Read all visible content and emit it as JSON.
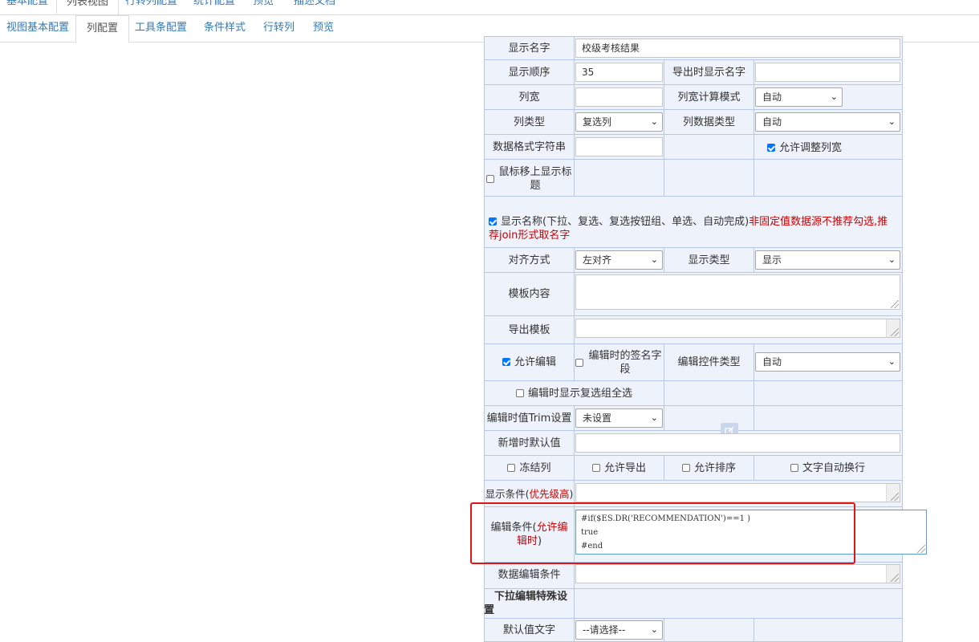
{
  "top_tabs": [
    "基本配置",
    "列表视图",
    "行转列配置",
    "统计配置",
    "预览",
    "描述文档"
  ],
  "sub_tabs": [
    "视图基本配置",
    "列配置",
    "工具条配置",
    "条件样式",
    "行转列",
    "预览"
  ],
  "rows": {
    "display_name_label": "显示名字",
    "display_name_value": "校级考核结果",
    "display_order_label": "显示顺序",
    "display_order_value": "35",
    "export_name_label": "导出时显示名字",
    "col_width_label": "列宽",
    "col_width_mode_label": "列宽计算模式",
    "col_width_mode_value": "自动",
    "col_type_label": "列类型",
    "col_type_value": "复选列",
    "col_data_type_label": "列数据类型",
    "col_data_type_value": "自动",
    "data_format_label": "数据格式字符串",
    "allow_resize_label": "允许调整列宽",
    "hover_title_label": "鼠标移上显示标题",
    "show_name_label": "显示名称(下拉、复选、复选按钮组、单选、自动完成)",
    "show_name_warning": "非固定值数据源不推荐勾选,推荐join形式取名字",
    "align_label": "对齐方式",
    "align_value": "左对齐",
    "display_type_label": "显示类型",
    "display_type_value": "显示",
    "template_label": "模板内容",
    "export_template_label": "导出模板",
    "allow_edit_label": "允许编辑",
    "sign_field_label": "编辑时的签名字段",
    "edit_ctrl_type_label": "编辑控件类型",
    "edit_ctrl_type_value": "自动",
    "edit_show_checkall_label": "编辑时显示复选组全选",
    "trim_label": "编辑时值Trim设置",
    "trim_value": "未设置",
    "default_new_label": "新增时默认值",
    "freeze_label": "冻结列",
    "allow_export_label": "允许导出",
    "allow_sort_label": "允许排序",
    "wrap_label": "文字自动换行",
    "show_cond_label": "显示条件(",
    "show_cond_red": "优先级高",
    "show_cond_close": ")",
    "edit_cond_label": "编辑条件(",
    "edit_cond_red": "允许编辑时",
    "edit_cond_close": ")",
    "edit_cond_code_1": "#if($ES.DR('RECOMMENDATION')==1 )",
    "edit_cond_code_2": "true",
    "edit_cond_code_3": "#end",
    "data_edit_cond_label": "数据编辑条件",
    "dropdown_special_label": "下拉编辑特殊设置",
    "default_text_label": "默认值文字",
    "default_text_value": "--请选择--"
  }
}
